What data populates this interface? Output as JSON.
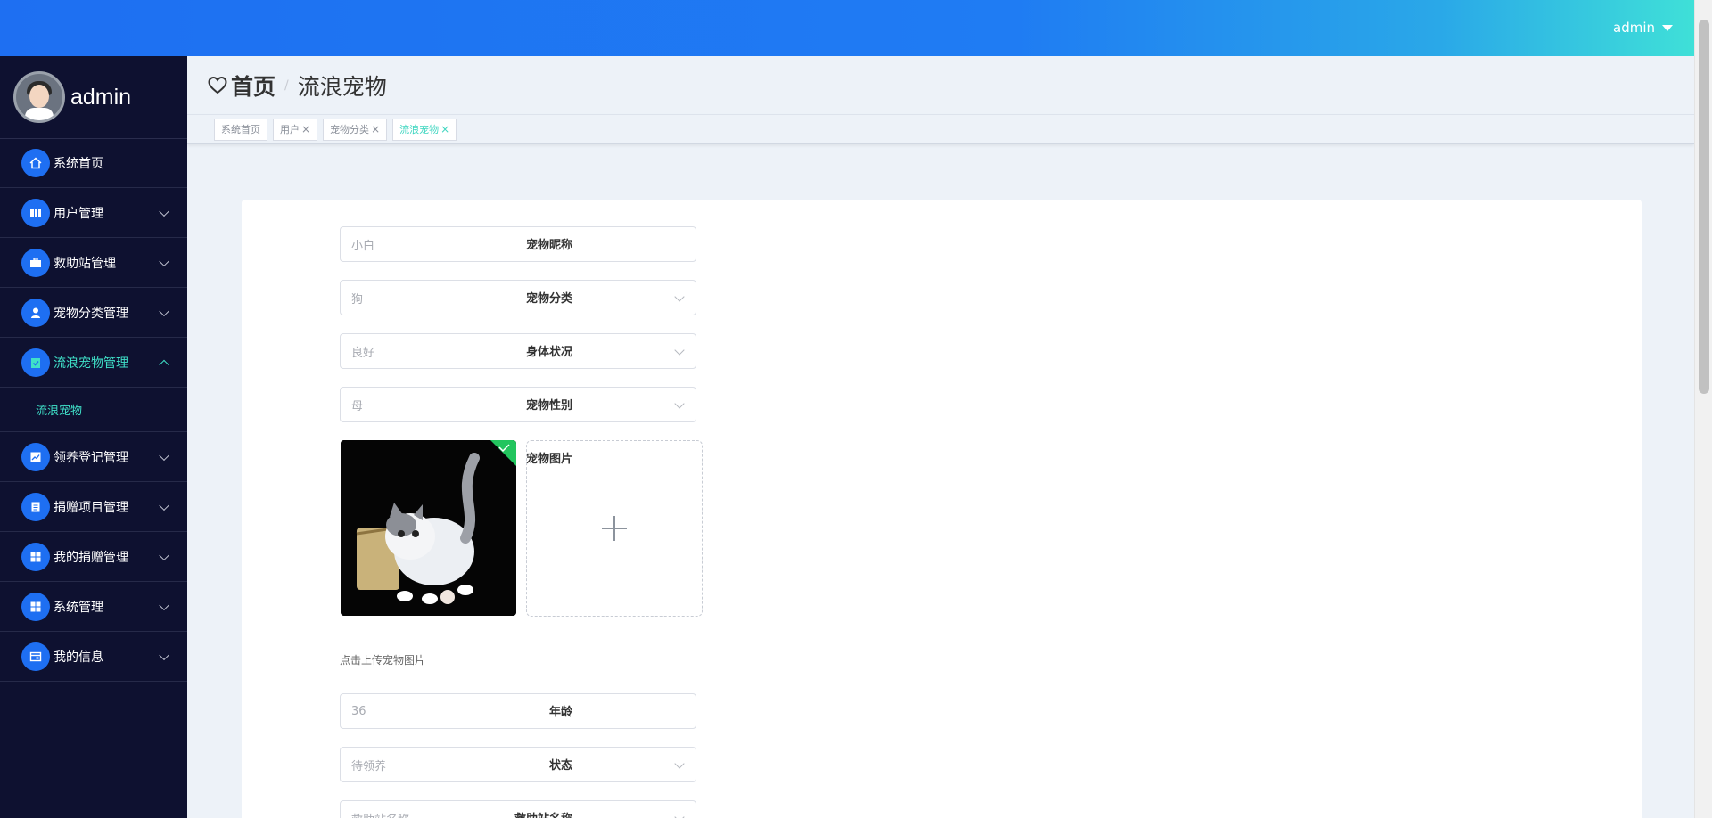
{
  "topbar": {
    "username": "admin"
  },
  "sidebar": {
    "profile_name": "admin",
    "items": [
      {
        "label": "系统首页",
        "icon": "home-icon",
        "expanded": null
      },
      {
        "label": "用户管理",
        "icon": "book-icon",
        "expanded": false
      },
      {
        "label": "救助站管理",
        "icon": "briefcase-icon",
        "expanded": false
      },
      {
        "label": "宠物分类管理",
        "icon": "user-icon",
        "expanded": false
      },
      {
        "label": "流浪宠物管理",
        "icon": "clipboard-check-icon",
        "expanded": true,
        "active": true
      },
      {
        "label": "领养登记管理",
        "icon": "chart-icon",
        "expanded": false
      },
      {
        "label": "捐赠项目管理",
        "icon": "document-icon",
        "expanded": false
      },
      {
        "label": "我的捐赠管理",
        "icon": "grid-icon",
        "expanded": false
      },
      {
        "label": "系统管理",
        "icon": "grid-icon",
        "expanded": false
      },
      {
        "label": "我的信息",
        "icon": "card-icon",
        "expanded": false
      }
    ],
    "submenu": {
      "label": "流浪宠物"
    }
  },
  "breadcrumb": {
    "home": "首页",
    "separator": "/",
    "current": "流浪宠物"
  },
  "tags": [
    {
      "label": "系统首页",
      "closable": false,
      "active": false
    },
    {
      "label": "用户",
      "closable": true,
      "active": false
    },
    {
      "label": "宠物分类",
      "closable": true,
      "active": false
    },
    {
      "label": "流浪宠物",
      "closable": true,
      "active": true
    }
  ],
  "tag_close": "×",
  "form": {
    "nickname": {
      "label": "宠物昵称",
      "value": "小白"
    },
    "category": {
      "label": "宠物分类",
      "value": "狗"
    },
    "health": {
      "label": "身体状况",
      "value": "良好"
    },
    "gender": {
      "label": "宠物性别",
      "value": "母"
    },
    "image": {
      "label": "宠物图片",
      "hint": "点击上传宠物图片"
    },
    "age": {
      "label": "年龄",
      "value": "36"
    },
    "status": {
      "label": "状态",
      "value": "待领养"
    },
    "station": {
      "label": "救助站名称",
      "value": "救助站名称"
    }
  },
  "colors": {
    "accent": "#1e6ff2",
    "active": "#3fe0c8",
    "sidebar_bg": "#0e1130"
  }
}
